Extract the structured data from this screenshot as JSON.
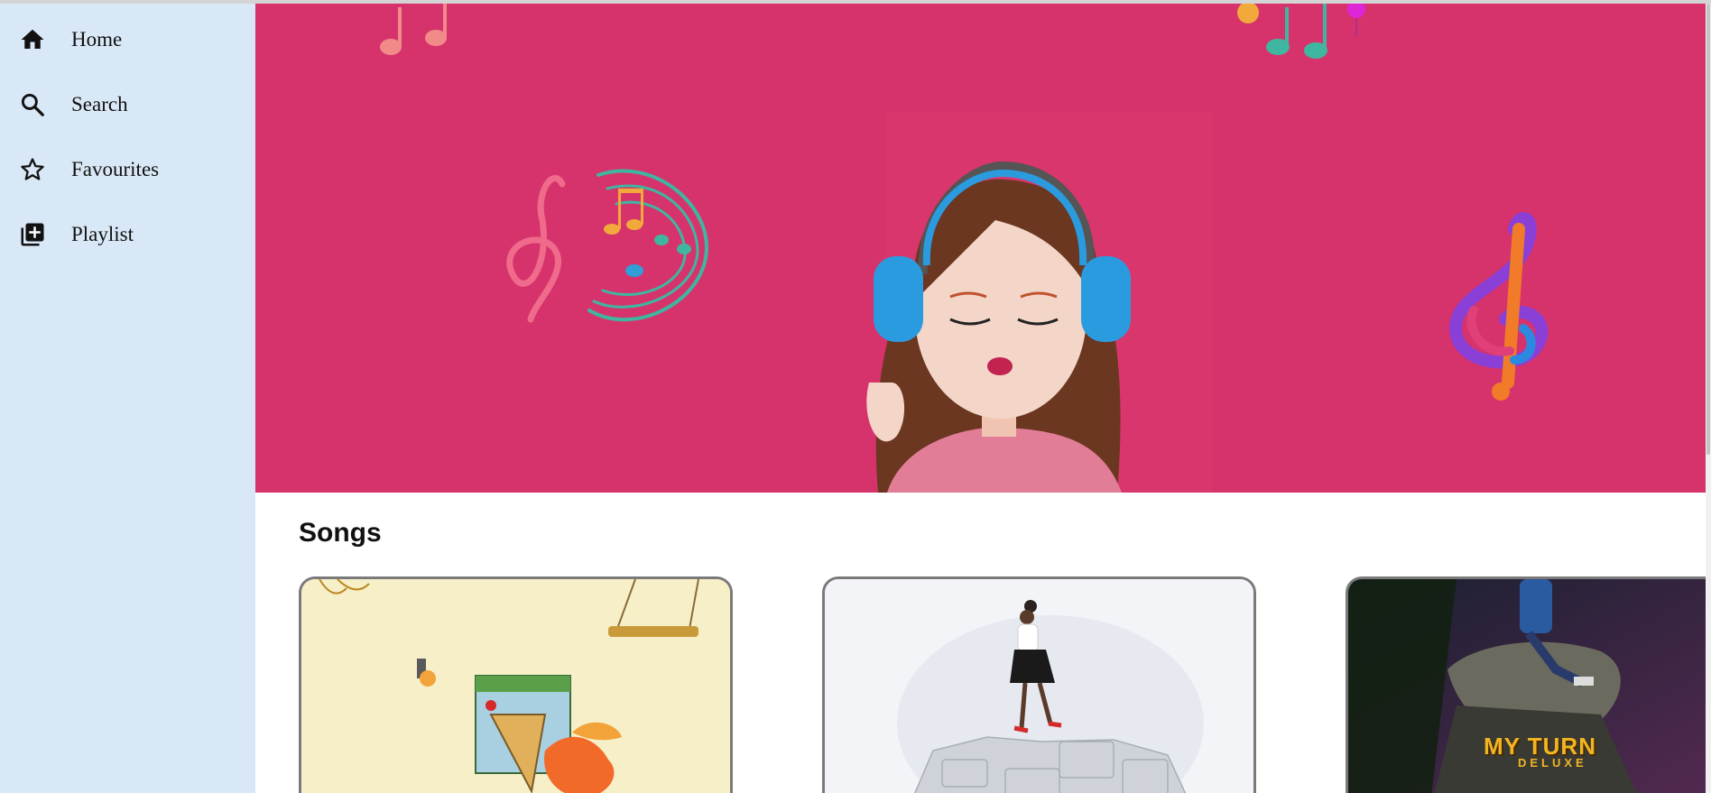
{
  "sidebar": {
    "items": [
      {
        "label": "Home",
        "icon": "home-icon"
      },
      {
        "label": "Search",
        "icon": "search-icon"
      },
      {
        "label": "Favourites",
        "icon": "star-icon"
      },
      {
        "label": "Playlist",
        "icon": "add-to-playlist-icon"
      }
    ]
  },
  "main": {
    "section_title": "Songs",
    "cards": [
      {
        "overlay_title": "",
        "overlay_subtitle": ""
      },
      {
        "overlay_title": "",
        "overlay_subtitle": ""
      },
      {
        "overlay_title": "MY TURN",
        "overlay_subtitle": "DELUXE"
      }
    ]
  },
  "colors": {
    "sidebar_bg": "#d9e8f7",
    "hero_bg": "#d6336c",
    "card_border": "#7a7a7a"
  }
}
